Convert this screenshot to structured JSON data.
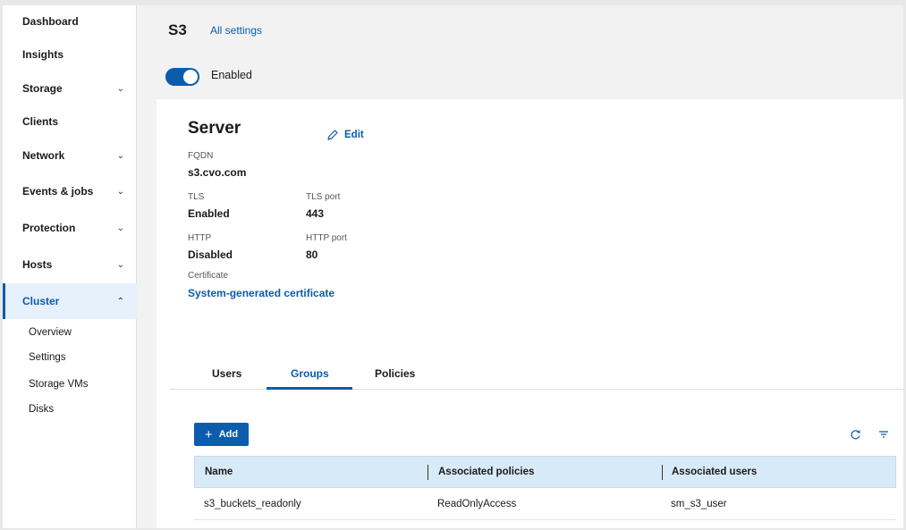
{
  "sidebar": {
    "items": [
      {
        "label": "Dashboard",
        "chevron": ""
      },
      {
        "label": "Insights",
        "chevron": ""
      },
      {
        "label": "Storage",
        "chevron": "⌄"
      },
      {
        "label": "Clients",
        "chevron": ""
      },
      {
        "label": "Network",
        "chevron": "⌄"
      },
      {
        "label": "Events & jobs",
        "chevron": "⌄"
      },
      {
        "label": "Protection",
        "chevron": "⌄"
      },
      {
        "label": "Hosts",
        "chevron": "⌄"
      },
      {
        "label": "Cluster",
        "chevron": "⌃"
      }
    ],
    "subitems": [
      "Overview",
      "Settings",
      "Storage VMs",
      "Disks"
    ]
  },
  "header": {
    "title": "S3",
    "all_settings": "All settings",
    "toggle_label": "Enabled"
  },
  "server": {
    "title": "Server",
    "edit_label": "Edit",
    "fqdn_label": "FQDN",
    "fqdn_value": "s3.cvo.com",
    "tls_label": "TLS",
    "tls_value": "Enabled",
    "tls_port_label": "TLS port",
    "tls_port_value": "443",
    "http_label": "HTTP",
    "http_value": "Disabled",
    "http_port_label": "HTTP port",
    "http_port_value": "80",
    "certificate_label": "Certificate",
    "certificate_value": "System-generated certificate"
  },
  "tabs": [
    "Users",
    "Groups",
    "Policies"
  ],
  "toolbar": {
    "add_label": "Add"
  },
  "table": {
    "columns": [
      "Name",
      "Associated policies",
      "Associated users"
    ],
    "rows": [
      [
        "s3_buckets_readonly",
        "ReadOnlyAccess",
        "sm_s3_user"
      ]
    ]
  },
  "colors": {
    "accent": "#0b5cad",
    "header_bg": "#d7eaf8",
    "active_nav_bg": "#e6f1fb"
  }
}
